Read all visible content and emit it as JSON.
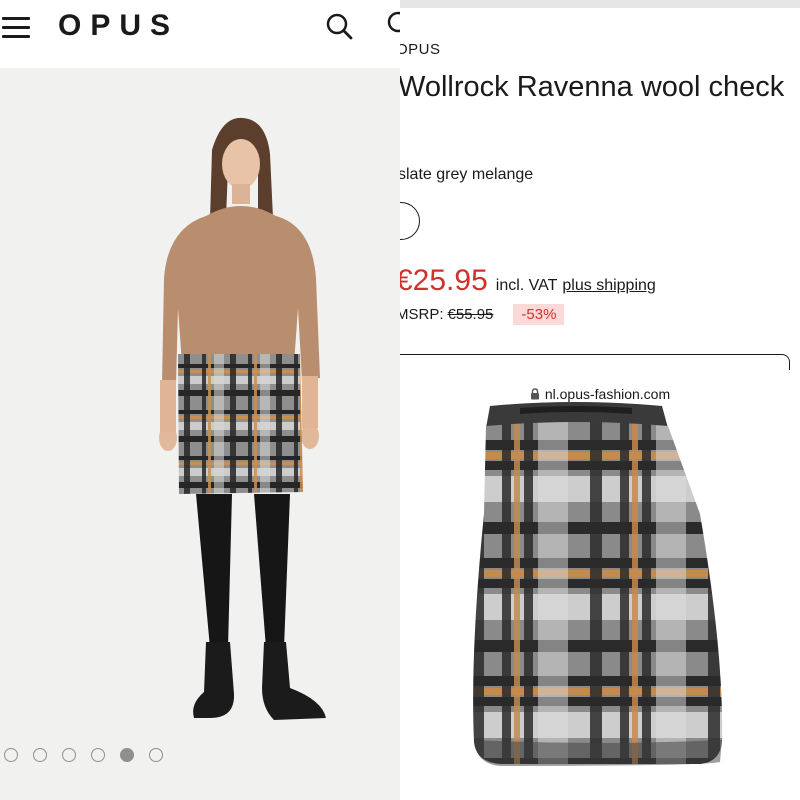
{
  "header": {
    "logo_text": "OPUS",
    "menu_icon": "hamburger-menu-icon",
    "search_icon": "search-icon"
  },
  "gallery": {
    "image_count": 6,
    "active_index": 4
  },
  "product": {
    "brand": "OPUS",
    "title": "Wollrock Ravenna wool check",
    "color_name": "slate grey melange",
    "price": "€25.95",
    "vat_label": "incl. VAT",
    "shipping_link": "plus shipping",
    "msrp_label": "MSRP:",
    "old_price": "€55.95",
    "discount": "-53%"
  },
  "browser": {
    "url": "nl.opus-fashion.com",
    "lock_icon": "lock-icon"
  },
  "colors": {
    "sale_red": "#d0312d",
    "discount_bg": "#fbd9d9",
    "text": "#1a1a1a",
    "photo_bg": "#f1f1f0"
  }
}
